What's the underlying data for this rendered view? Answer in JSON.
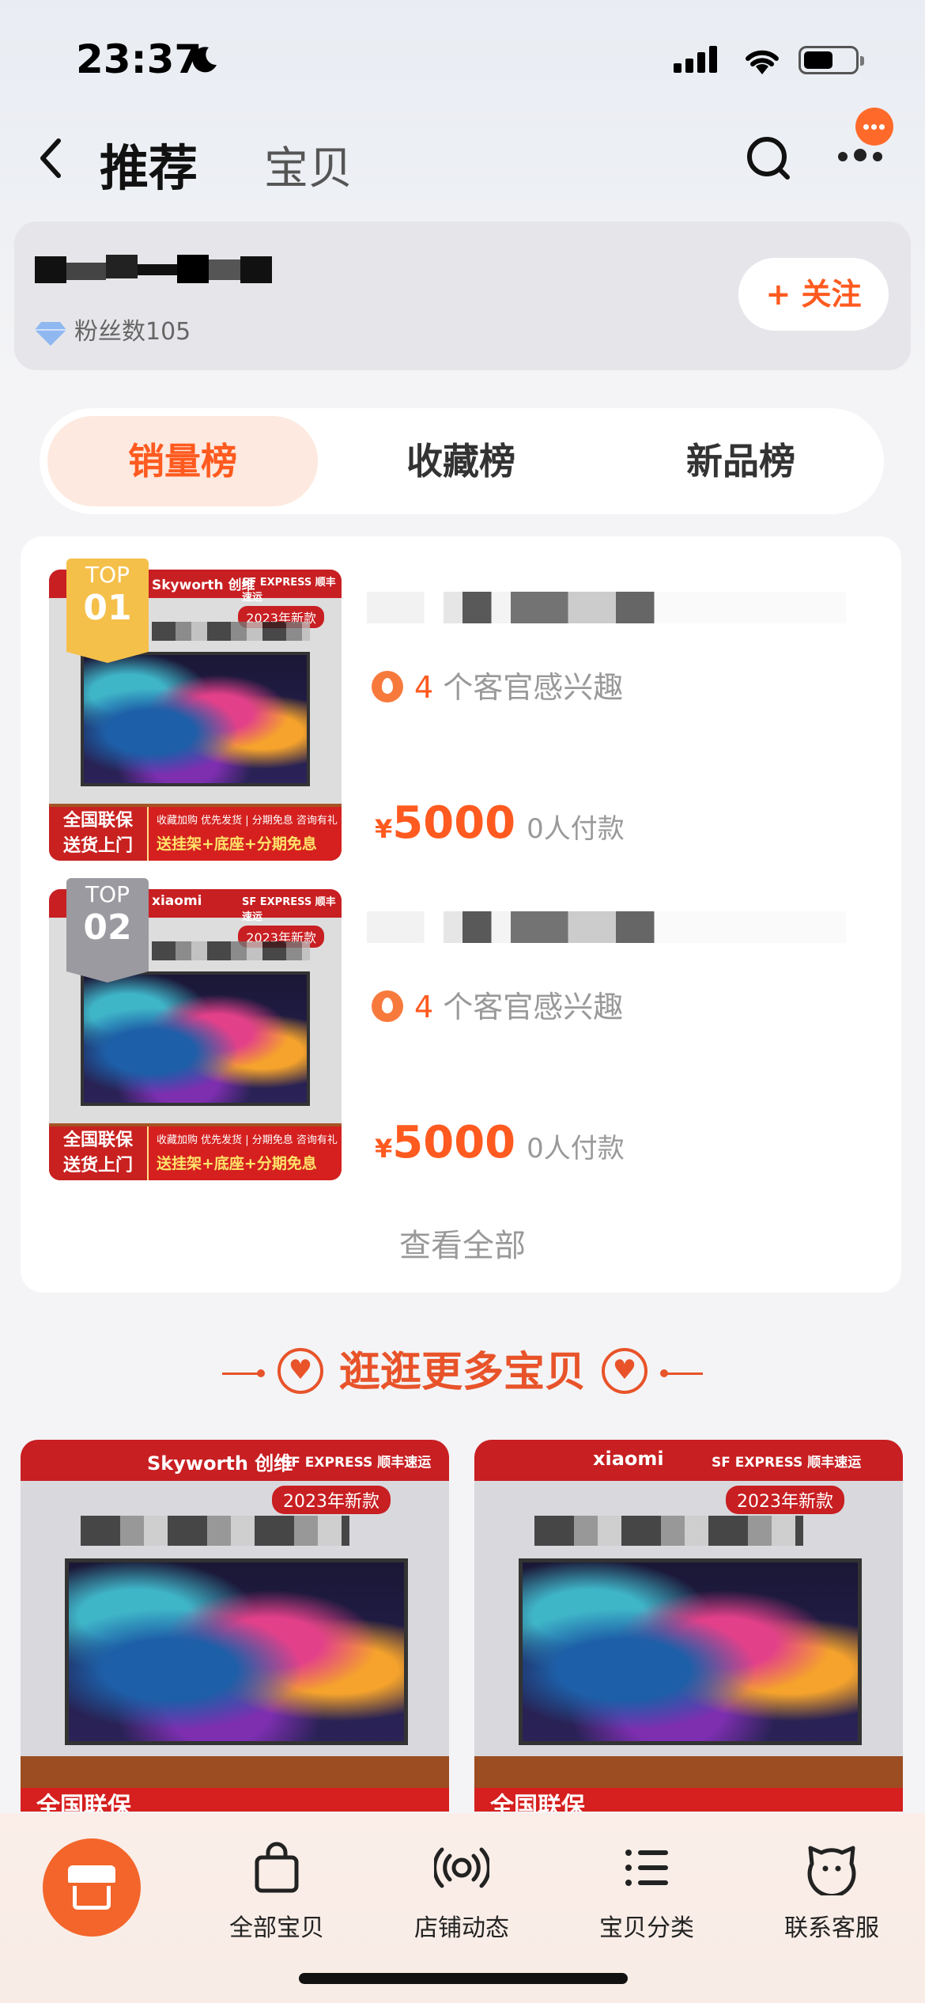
{
  "status_bar": {
    "time": "23:37"
  },
  "nav": {
    "title": "推荐",
    "subtitle": "宝贝"
  },
  "store": {
    "fans_label": "粉丝数",
    "fans_count": "105",
    "follow_label": "+ 关注"
  },
  "tabs": [
    {
      "label": "销量榜",
      "active": true
    },
    {
      "label": "收藏榜",
      "active": false
    },
    {
      "label": "新品榜",
      "active": false
    }
  ],
  "ranking": [
    {
      "tag_top": "TOP",
      "tag_num": "01",
      "interest_count": "4",
      "interest_text": " 个客官感兴趣",
      "currency": "¥",
      "price": "5000",
      "paid": "0人付款",
      "thumb": {
        "brand": "Skyworth 创维",
        "logistics": "SF EXPRESS 顺丰速运",
        "new_badge": "2023年新款",
        "promo_left": "全国联保\n送货上门",
        "promo_small": "收藏加购 优先发货 | 分期免息 咨询有礼",
        "promo_big": "送挂架+底座+分期免息"
      }
    },
    {
      "tag_top": "TOP",
      "tag_num": "02",
      "interest_count": "4",
      "interest_text": " 个客官感兴趣",
      "currency": "¥",
      "price": "5000",
      "paid": "0人付款",
      "thumb": {
        "brand": "xiaomi",
        "logistics": "SF EXPRESS 顺丰速运",
        "new_badge": "2023年新款",
        "promo_left": "全国联保\n送货上门",
        "promo_small": "收藏加购 优先发货 | 分期免息 咨询有礼",
        "promo_big": "送挂架+底座+分期免息"
      }
    }
  ],
  "view_all": "查看全部",
  "more_section_title": "逛逛更多宝贝",
  "grid": [
    {
      "brand": "Skyworth 创维",
      "logistics": "SF EXPRESS 顺丰速运",
      "new_badge": "2023年新款",
      "promo": "全国联保"
    },
    {
      "brand": "xiaomi",
      "logistics": "SF EXPRESS 顺丰速运",
      "new_badge": "2023年新款",
      "promo": "全国联保"
    }
  ],
  "tabbar": [
    {
      "label": "全部宝贝",
      "icon": "shopping-bag-icon"
    },
    {
      "label": "店铺动态",
      "icon": "broadcast-icon"
    },
    {
      "label": "宝贝分类",
      "icon": "list-icon"
    },
    {
      "label": "联系客服",
      "icon": "customer-service-icon"
    }
  ],
  "colors": {
    "accent": "#ff5a1f",
    "brand_red": "#c81f22"
  }
}
